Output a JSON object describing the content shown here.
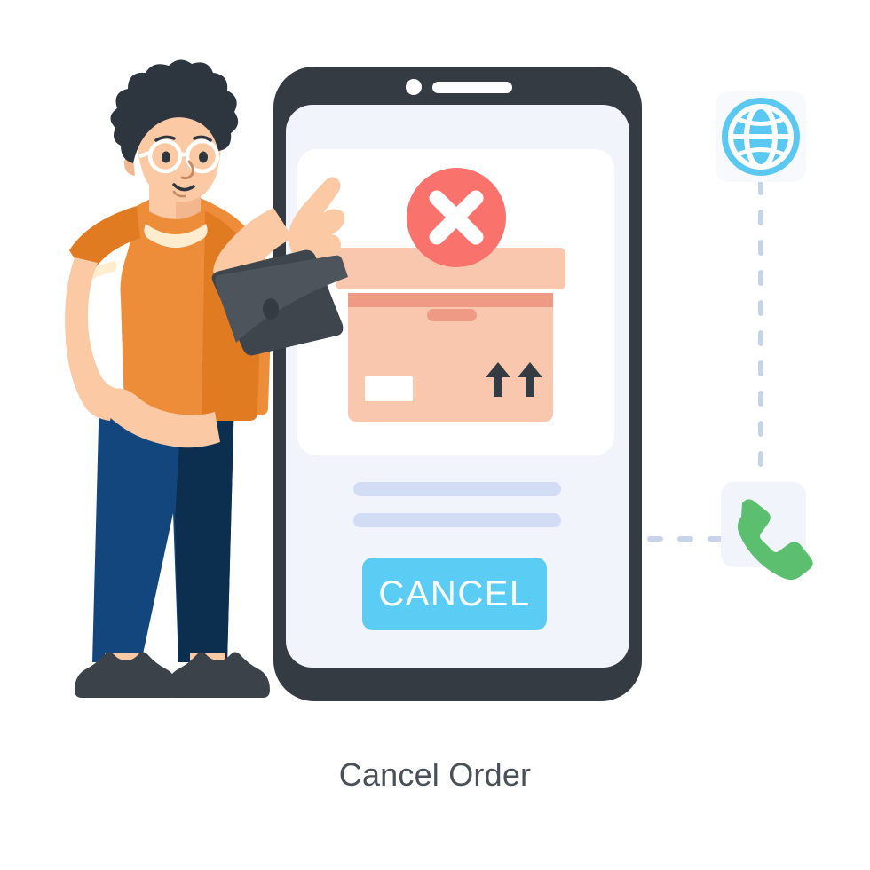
{
  "illustration": {
    "title": "Cancel Order",
    "caption_color": "#4a5057",
    "background": "#ffffff"
  },
  "phone": {
    "frame_color": "#343b43",
    "screen_color": "#f2f4fb",
    "speaker_color": "#ffffff",
    "camera_color": "#ffffff",
    "card": {
      "background": "#ffffff",
      "status_icon": "error-cross-circle-icon",
      "status_icon_color": "#f9726c",
      "status_icon_mark_color": "#ffffff",
      "package": {
        "icon": "package-box-icon",
        "lid_color": "#f9c7ad",
        "body_color": "#f9c7ad",
        "tape_color": "#ef9a85",
        "label_color": "#ffffff",
        "fragile_arrows": "this-way-up-arrows-icon",
        "arrow_color": "#343b43"
      }
    },
    "placeholder_lines": [
      {
        "name": "text-line-1",
        "color": "#d3dcf5"
      },
      {
        "name": "text-line-2",
        "color": "#d3dcf5"
      }
    ],
    "cancel_button": {
      "label": "CANCEL",
      "background": "#5bcdf4",
      "text_color": "#ffffff"
    }
  },
  "character": {
    "name": "person-with-laptop",
    "hair_color": "#2d353e",
    "skin_color": "#fbc9a4",
    "skin_shadow": "#f3b78f",
    "glasses_color": "#ffffff",
    "shirt_color": "#ed8d3a",
    "shirt_shadow": "#e17b21",
    "collar_highlight": "#fdeccd",
    "pants_color": "#13467c",
    "pants_shadow": "#0d2f4f",
    "shoe_color": "#3c4249",
    "laptop_color": "#3e454d",
    "laptop_highlight": "#4d545c",
    "laptop_dot": "#343b43"
  },
  "side_icons": [
    {
      "name": "globe-icon",
      "label": "globe",
      "icon_color": "#5bc8f2",
      "tile_color": "#f7f9fd"
    },
    {
      "name": "phone-call-icon",
      "label": "phone handset",
      "icon_color": "#5cbf70",
      "tile_color": "#f1f4fa"
    }
  ],
  "connectors": {
    "color": "#c7d3e8",
    "style": "dashed",
    "paths": [
      "globe-to-phone-vertical",
      "phone-to-device-horizontal"
    ]
  }
}
